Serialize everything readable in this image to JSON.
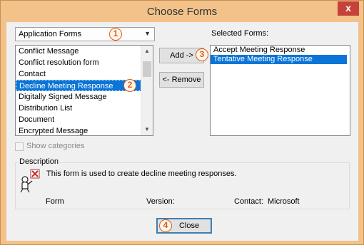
{
  "window": {
    "title": "Choose Forms",
    "close_glyph": "x"
  },
  "form_source": {
    "selected": "Application Forms"
  },
  "available_forms": {
    "items": [
      "Conflict Message",
      "Conflict resolution form",
      "Contact",
      "Decline Meeting Response",
      "Digitally Signed Message",
      "Distribution List",
      "Document",
      "Encrypted Message"
    ],
    "selected_index": 3
  },
  "buttons": {
    "add": "Add ->",
    "remove": "<- Remove",
    "close": "Close"
  },
  "selected_forms": {
    "label": "Selected Forms:",
    "items": [
      "Accept Meeting Response",
      "Tentative Meeting Response"
    ],
    "selected_index": 1
  },
  "show_categories": {
    "label": "Show categories",
    "checked": false,
    "enabled": false
  },
  "description": {
    "group_title": "Description",
    "text": "This form is used to create decline meeting responses.",
    "form_label": "Form",
    "version_label": "Version:",
    "contact_label": "Contact:",
    "contact_value": "Microsoft"
  },
  "callouts": [
    "1",
    "2",
    "3",
    "4"
  ],
  "colors": {
    "accent_callout": "#e05a12",
    "selection": "#0a75d6",
    "frame": "#f2c28a"
  }
}
